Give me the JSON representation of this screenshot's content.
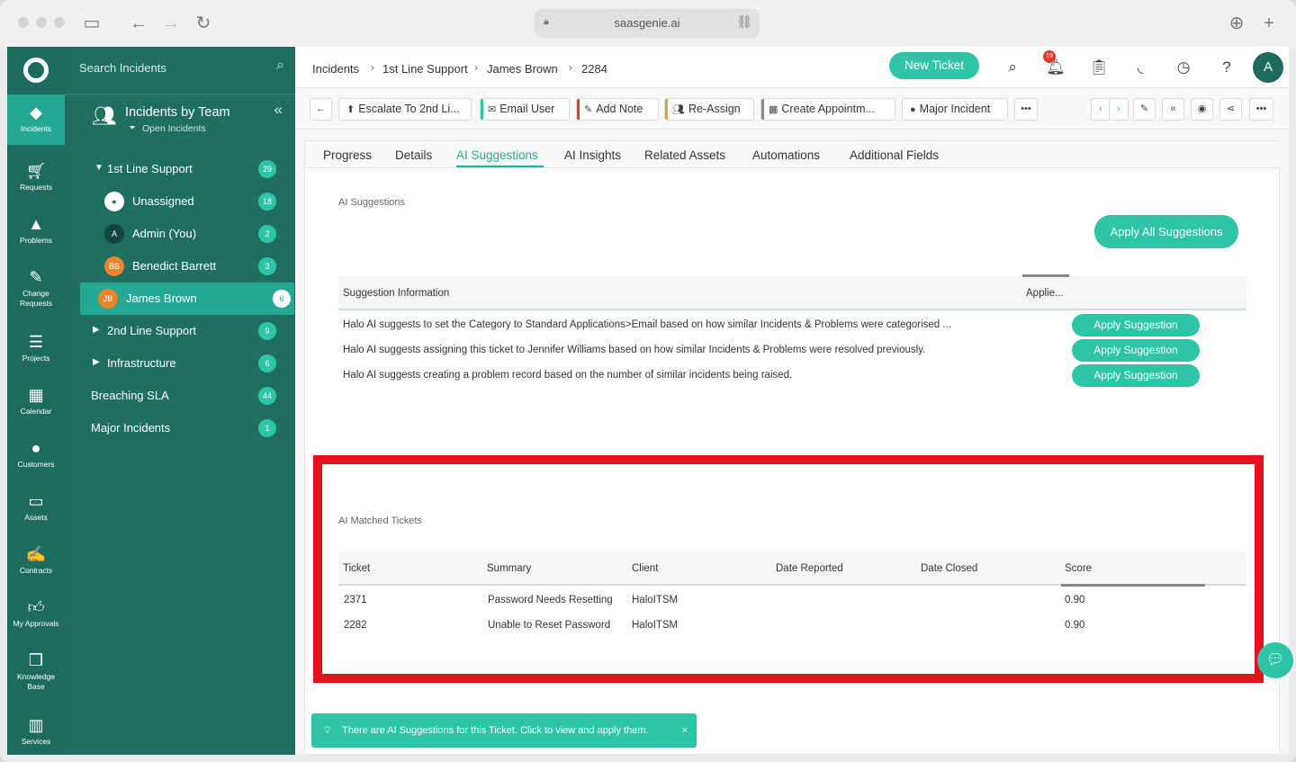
{
  "browser": {
    "url": "saasgenie.ai"
  },
  "rail": {
    "items": [
      {
        "label": "Incidents",
        "icon": "incidents-icon"
      },
      {
        "label": "Requests",
        "icon": "cart-icon"
      },
      {
        "label": "Problems",
        "icon": "warning-icon"
      },
      {
        "label": "Change Requests",
        "icon": "edit-icon"
      },
      {
        "label": "Projects",
        "icon": "projects-icon"
      },
      {
        "label": "Calendar",
        "icon": "calendar-icon"
      },
      {
        "label": "Customers",
        "icon": "customer-icon"
      },
      {
        "label": "Assets",
        "icon": "laptop-icon"
      },
      {
        "label": "Contracts",
        "icon": "contract-icon"
      },
      {
        "label": "My Approvals",
        "icon": "thumbs-up-icon"
      },
      {
        "label": "Knowledge Base",
        "icon": "book-icon"
      },
      {
        "label": "Services",
        "icon": "services-icon"
      }
    ]
  },
  "panel": {
    "search_placeholder": "Search Incidents",
    "title": "Incidents by Team",
    "subtitle": "Open Incidents",
    "rows": [
      {
        "label": "1st Line Support",
        "count": "29"
      },
      {
        "label": "Unassigned",
        "count": "18"
      },
      {
        "label": "Admin (You)",
        "count": "2",
        "avatar": "A"
      },
      {
        "label": "Benedict Barrett",
        "count": "3",
        "avatar": "BB"
      },
      {
        "label": "James Brown",
        "count": "6",
        "avatar": "JB"
      },
      {
        "label": "2nd Line Support",
        "count": "9"
      },
      {
        "label": "Infrastructure",
        "count": "6"
      },
      {
        "label": "Breaching SLA",
        "count": "44"
      },
      {
        "label": "Major Incidents",
        "count": "1"
      }
    ]
  },
  "topbar": {
    "breadcrumb": [
      "Incidents",
      "1st Line Support",
      "James Brown",
      "2284"
    ],
    "new_ticket": "New Ticket",
    "notification_count": "19",
    "user_initial": "A"
  },
  "toolbar": {
    "buttons": [
      {
        "label": "Escalate To 2nd Li...",
        "color": "#ffffff"
      },
      {
        "label": "Email User",
        "color": "#2ec4a6"
      },
      {
        "label": "Add Note",
        "color": "#e53935"
      },
      {
        "label": "Re-Assign",
        "color": "#f0a030"
      },
      {
        "label": "Create Appointm...",
        "color": "#888888"
      },
      {
        "label": "Major Incident",
        "color": "#ffffff"
      }
    ],
    "more": "•••"
  },
  "tabs": [
    "Progress",
    "Details",
    "AI Suggestions",
    "AI Insights",
    "Related Assets",
    "Automations",
    "Additional Fields"
  ],
  "suggestions": {
    "section_label": "AI Suggestions",
    "apply_all": "Apply All Suggestions",
    "headers": [
      "Suggestion Information",
      "Applie..."
    ],
    "rows": [
      "Halo AI suggests to set the Category to Standard Applications>Email based on how similar Incidents & Problems were categorised ...",
      "Halo AI suggests assigning this ticket to Jennifer Williams based on how similar Incidents & Problems were resolved previously.",
      "Halo AI suggests creating a problem record based on the number of similar incidents being raised."
    ],
    "apply_label": "Apply Suggestion"
  },
  "matched": {
    "section_label": "AI Matched Tickets",
    "headers": [
      "Ticket",
      "Summary",
      "Client",
      "Date Reported",
      "Date Closed",
      "Score"
    ],
    "rows": [
      {
        "ticket": "2371",
        "summary": "Password Needs Resetting",
        "client": "HaloITSM",
        "reported": "",
        "closed": "",
        "score": "0.90"
      },
      {
        "ticket": "2282",
        "summary": "Unable to Reset Password",
        "client": "HaloITSM",
        "reported": "",
        "closed": "",
        "score": "0.90"
      }
    ]
  },
  "toast": {
    "text": "There are AI Suggestions for this Ticket. Click to view and apply them.",
    "close": "×"
  }
}
